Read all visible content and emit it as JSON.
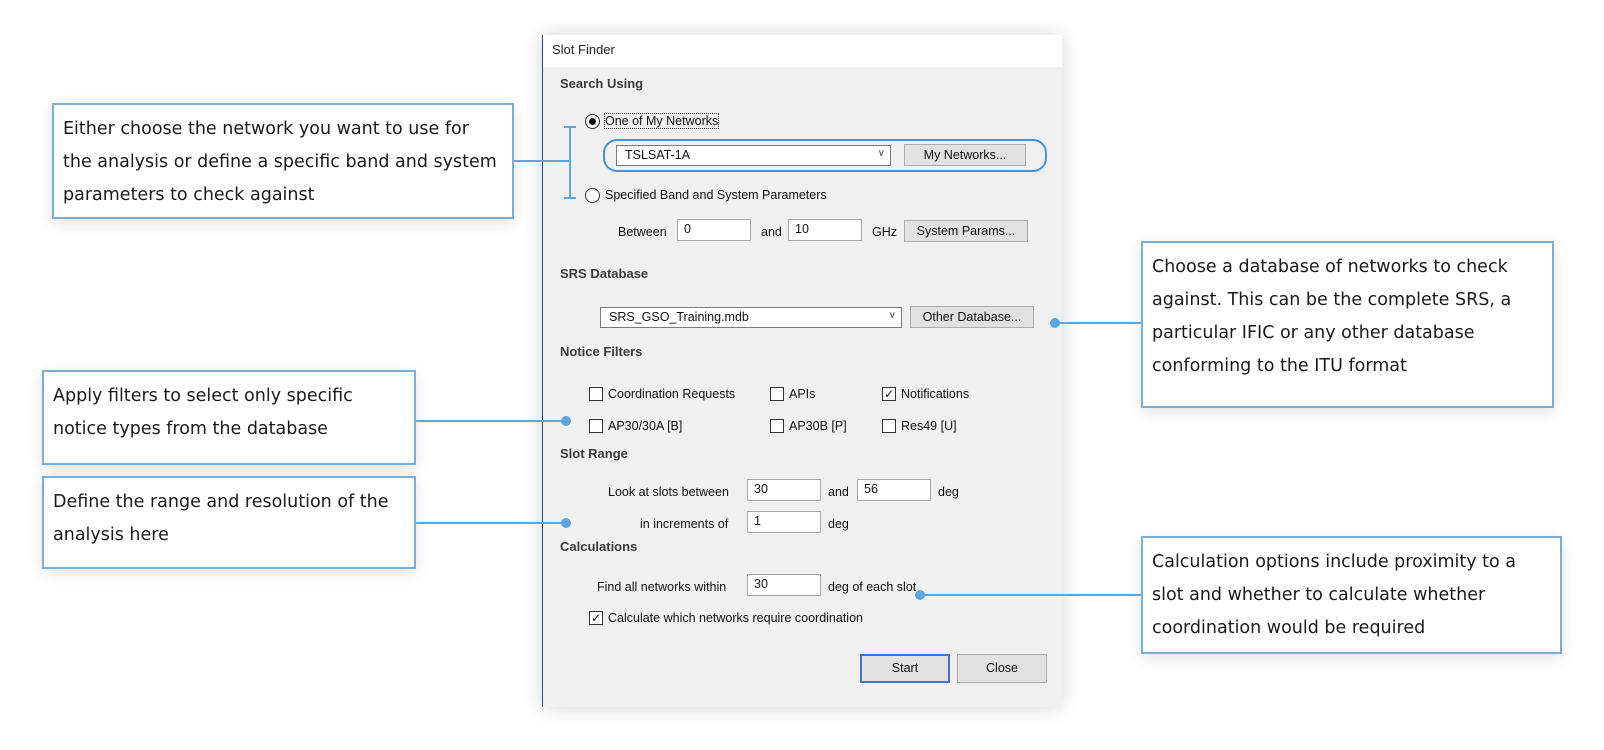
{
  "window": {
    "title": "Slot Finder"
  },
  "search_using": {
    "header": "Search Using",
    "option_networks": "One of My Networks",
    "option_networks_selected": true,
    "network_value": "TSLSAT-1A",
    "my_networks_button": "My Networks...",
    "option_band": "Specified Band and System Parameters",
    "option_band_selected": false,
    "between_label": "Between",
    "freq_from": "0",
    "and_label": "and",
    "freq_to": "10",
    "unit_ghz": "GHz",
    "system_params_button": "System Params..."
  },
  "srs_database": {
    "header": "SRS Database",
    "value": "SRS_GSO_Training.mdb",
    "other_button": "Other Database..."
  },
  "notice_filters": {
    "header": "Notice Filters",
    "items": [
      {
        "label": "Coordination Requests",
        "checked": false
      },
      {
        "label": "APIs",
        "checked": false
      },
      {
        "label": "Notifications",
        "checked": true
      },
      {
        "label": "AP30/30A [B]",
        "checked": false
      },
      {
        "label": "AP30B [P]",
        "checked": false
      },
      {
        "label": "Res49 [U]",
        "checked": false
      }
    ]
  },
  "slot_range": {
    "header": "Slot Range",
    "look_label": "Look at slots between",
    "from": "30",
    "and_label": "and",
    "to": "56",
    "deg1": "deg",
    "increment_label": "in increments of",
    "increment": "1",
    "deg2": "deg"
  },
  "calculations": {
    "header": "Calculations",
    "find_label": "Find all networks within",
    "within": "30",
    "suffix": "deg of each slot",
    "coord_label": "Calculate which networks require coordination",
    "coord_checked": true
  },
  "buttons": {
    "start": "Start",
    "close": "Close"
  },
  "callouts": {
    "network": "Either choose the network you want to use for the analysis or define a specific band and system parameters to check against",
    "database": "Choose a database of networks to check against. This can be the complete SRS, a particular IFIC or any other database conforming to the ITU format",
    "filters": "Apply filters to select only specific notice types from the database",
    "range": "Define the range and resolution of the analysis here",
    "calc": "Calculation options include proximity to a slot and whether to calculate whether coordination would be required"
  },
  "colors": {
    "accent": "#5aa7e0",
    "callout_border": "#7aaed6",
    "default_button": "#3b78c9"
  }
}
